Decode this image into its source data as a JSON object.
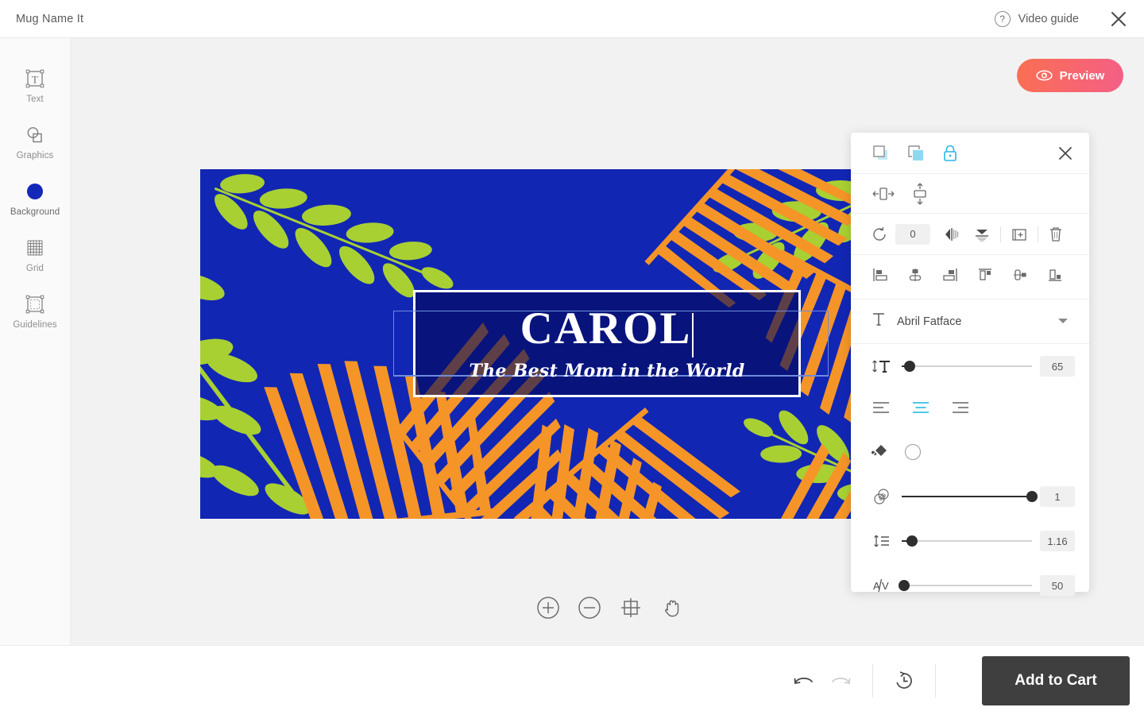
{
  "app": {
    "title": "Mug Name It",
    "video_guide_label": "Video guide",
    "close_label": "×"
  },
  "sidebar": {
    "items": [
      {
        "label": "Text",
        "icon": "text-box-icon",
        "active": false
      },
      {
        "label": "Graphics",
        "icon": "shapes-icon",
        "active": false
      },
      {
        "label": "Background",
        "icon": "color-circle-icon",
        "active": true
      },
      {
        "label": "Grid",
        "icon": "grid-icon",
        "active": false
      },
      {
        "label": "Guidelines",
        "icon": "guidelines-icon",
        "active": false
      }
    ]
  },
  "canvas": {
    "preview_button": "Preview",
    "preview_icon": "eye-icon",
    "artwork": {
      "background_color": "#1226b4",
      "leaf_green": "#a8d033",
      "leaf_orange": "#f59528",
      "name_text": "CAROL",
      "subtitle_text": "The Best Mom in the World",
      "text_color": "#ffffff"
    },
    "zoom_tools": [
      {
        "name": "zoom-in",
        "icon": "plus-circle-icon"
      },
      {
        "name": "zoom-out",
        "icon": "minus-circle-icon"
      },
      {
        "name": "fit-to-screen",
        "icon": "crosshair-frame-icon"
      },
      {
        "name": "pan-hand",
        "icon": "hand-icon"
      }
    ]
  },
  "properties_panel": {
    "close_icon": "close-icon",
    "layer_tools": [
      {
        "name": "bring-to-front",
        "icon": "bring-forward-icon",
        "accent": "#6fd3ef"
      },
      {
        "name": "send-to-back",
        "icon": "send-backward-icon",
        "accent": "#6fd3ef"
      },
      {
        "name": "lock-object",
        "icon": "lock-icon",
        "accent": "#29b6e8"
      }
    ],
    "center_tools": [
      {
        "name": "center-horizontally",
        "icon": "center-horizontal-icon"
      },
      {
        "name": "center-vertically",
        "icon": "center-vertical-icon"
      }
    ],
    "transform": {
      "rotation_icon": "rotate-icon",
      "rotation_value": "0",
      "flip_horizontal_icon": "flip-horizontal-icon",
      "flip_vertical_icon": "flip-vertical-icon",
      "duplicate_icon": "duplicate-icon",
      "delete_icon": "trash-icon"
    },
    "align_tools": [
      {
        "name": "align-left",
        "icon": "align-left-icon"
      },
      {
        "name": "align-center-horizontal",
        "icon": "align-center-h-icon"
      },
      {
        "name": "align-right",
        "icon": "align-right-icon"
      },
      {
        "name": "align-top",
        "icon": "align-top-icon"
      },
      {
        "name": "align-center-vertical",
        "icon": "align-center-v-icon"
      },
      {
        "name": "align-bottom",
        "icon": "align-bottom-icon"
      }
    ],
    "font": {
      "icon": "font-t-icon",
      "family": "Abril Fatface",
      "dropdown_icon": "chevron-down-icon"
    },
    "font_size": {
      "icon": "font-size-icon",
      "value": "65",
      "percent": 6
    },
    "text_align": {
      "options": [
        {
          "name": "text-align-left",
          "icon": "text-align-left-icon",
          "selected": false
        },
        {
          "name": "text-align-center",
          "icon": "text-align-center-icon",
          "selected": true
        },
        {
          "name": "text-align-right",
          "icon": "text-align-right-icon",
          "selected": false
        }
      ],
      "selected_color": "#4fc8ea"
    },
    "fill": {
      "icon": "paint-bucket-icon",
      "color": "#ffffff"
    },
    "opacity": {
      "icon": "opacity-circles-icon",
      "value": "1",
      "percent": 100
    },
    "line_height": {
      "icon": "line-height-icon",
      "value": "1.16",
      "percent": 8
    },
    "letter_spacing": {
      "icon": "letter-spacing-icon",
      "value": "50",
      "percent": 2
    }
  },
  "bottom_bar": {
    "undo_icon": "undo-icon",
    "redo_icon": "redo-icon",
    "history_icon": "history-clock-icon",
    "add_to_cart_label": "Add to Cart"
  }
}
